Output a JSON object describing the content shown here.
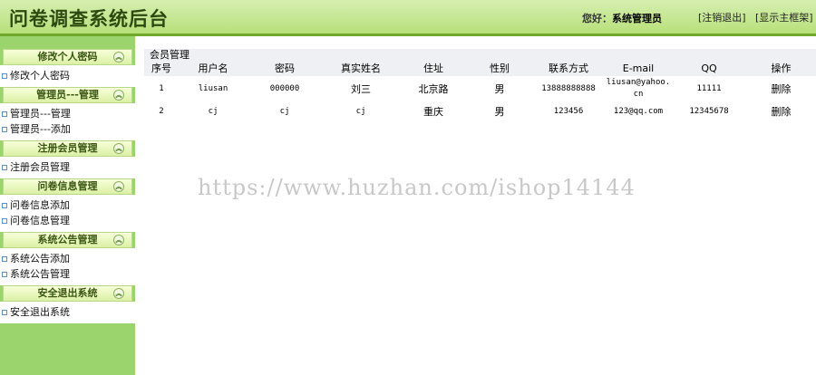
{
  "header": {
    "title": "问卷调查系统后台",
    "greeting_label": "您好：",
    "greeting_user": "系统管理员",
    "logout_link": "[注销退出]",
    "frame_link": "[显示主框架]"
  },
  "sidebar": {
    "groups": [
      {
        "title": "修改个人密码",
        "items": [
          "修改个人密码"
        ]
      },
      {
        "title": "管理员---管理",
        "items": [
          "管理员---管理",
          "管理员---添加"
        ]
      },
      {
        "title": "注册会员管理",
        "items": [
          "注册会员管理"
        ]
      },
      {
        "title": "问卷信息管理",
        "items": [
          "问卷信息添加",
          "问卷信息管理"
        ]
      },
      {
        "title": "系统公告管理",
        "items": [
          "系统公告添加",
          "系统公告管理"
        ]
      },
      {
        "title": "安全退出系统",
        "items": [
          "安全退出系统"
        ]
      }
    ]
  },
  "main": {
    "section_title": "会员管理",
    "columns": [
      "序号",
      "用户名",
      "密码",
      "真实姓名",
      "住址",
      "性别",
      "联系方式",
      "E-mail",
      "QQ",
      "操作"
    ],
    "rows": [
      [
        "1",
        "liusan",
        "000000",
        "刘三",
        "北京路",
        "男",
        "13888888888",
        "liusan@yahoo.cn",
        "11111",
        "删除"
      ],
      [
        "2",
        "cj",
        "cj",
        "cj",
        "重庆",
        "男",
        "123456",
        "123@qq.com",
        "12345678",
        "删除"
      ]
    ]
  },
  "watermark": "https://www.huzhan.com/ishop14144"
}
